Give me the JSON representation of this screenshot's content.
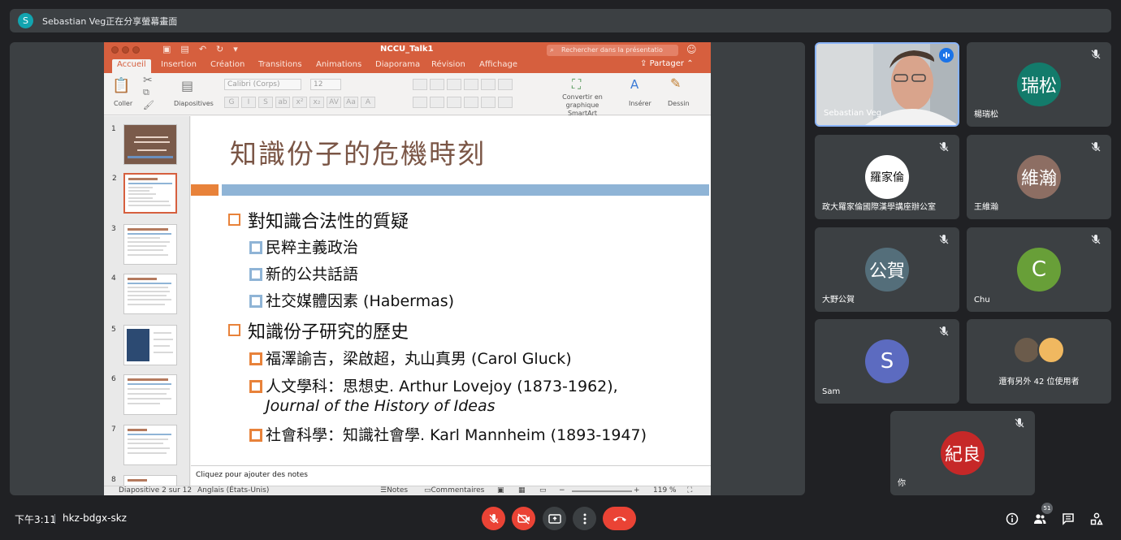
{
  "banner": {
    "avatar_letter": "S",
    "text": "Sebastian Veg正在分享螢幕畫面"
  },
  "ppt": {
    "doc_title": "NCCU_Talk1",
    "search_placeholder": "Rechercher dans la présentatio",
    "tabs": [
      "Accueil",
      "Insertion",
      "Création",
      "Transitions",
      "Animations",
      "Diaporama",
      "Révision",
      "Affichage"
    ],
    "share_label": "Partager",
    "ribbon": {
      "paste_label": "Coller",
      "layouts_label": "Diapositives",
      "font": "Calibri (Corps)",
      "size": "12",
      "smartart_label": "Convertir en graphique SmartArt",
      "insert_label": "Insérer",
      "draw_label": "Dessin"
    },
    "thumb_numbers": [
      "1",
      "2",
      "3",
      "4",
      "5",
      "6",
      "7",
      "8"
    ],
    "slide": {
      "title": "知識份子的危機時刻",
      "b1": "對知識合法性的質疑",
      "b1_1": "民粹主義政治",
      "b1_2": "新的公共話語",
      "b1_3": "社交媒體因素 (Habermas)",
      "b2": "知識份子研究的歷史",
      "b2_1": "福澤諭吉，梁啟超，丸山真男 (Carol Gluck)",
      "b2_2": "人文學科：思想史. Arthur Lovejoy (1873-1962),",
      "b2_2b": "Journal of the History of Ideas",
      "b2_3": "社會科學：知識社會學. Karl Mannheim (1893-1947)"
    },
    "notes_placeholder": "Cliquez pour ajouter des notes",
    "status": {
      "slide_info": "Diapositive 2 sur 12",
      "language": "Anglais (États-Unis)",
      "notes": "Notes",
      "comments": "Commentaires",
      "zoom": "119 %"
    }
  },
  "participants": [
    {
      "name": "Sebastian Veg"
    },
    {
      "name": "楊瑞松",
      "avatar": "瑞松",
      "color": "#137b6b"
    },
    {
      "name": "政大羅家倫國際漢學講座辦公室"
    },
    {
      "name": "王維瀚",
      "avatar": "維瀚",
      "color": "#8d6e63"
    },
    {
      "name": "大野公賀",
      "avatar": "公賀",
      "color": "#546e7a"
    },
    {
      "name": "Chu",
      "avatar": "C",
      "color": "#689f38"
    },
    {
      "name": "Sam",
      "avatar": "S",
      "color": "#5c6bc0"
    },
    {
      "name": "還有另外 42 位使用者"
    },
    {
      "name": "你",
      "avatar": "紀良",
      "color": "#c62828"
    }
  ],
  "logo_text": "羅家倫",
  "footer": {
    "time": "下午3:11",
    "meeting_code": "hkz-bdgx-skz",
    "people_count": "51"
  }
}
